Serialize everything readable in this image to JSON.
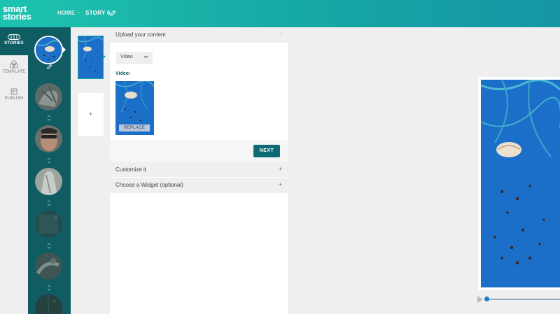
{
  "app": {
    "logo_line1": "smart",
    "logo_line2": "stories"
  },
  "breadcrumb": {
    "home": "HOME",
    "separator": "›",
    "current": "STORY 6"
  },
  "leftnav": {
    "stories": "STORIES",
    "template": "TEMPLATE",
    "publish": "PUBLISH"
  },
  "slides": {
    "add_label": "+"
  },
  "panel": {
    "upload_title": "Upload your content",
    "upload_sign": "-",
    "content_type": "Video",
    "video_label": "Video:",
    "replace_label": "REPLACE",
    "next_label": "NEXT",
    "customize_title": "Customize it",
    "customize_sign": "+",
    "widget_title": "Choose a Widget (optional)",
    "widget_sign": "+"
  },
  "colors": {
    "header_start": "#1ec3b0",
    "header_end": "#1596a7",
    "rail": "#0f5c62",
    "accent": "#0f6a76",
    "ocean_blue": "#1b6fc9"
  },
  "icons": [
    "edit-icon",
    "stories-icon",
    "template-icon",
    "publish-icon",
    "chevron-down-icon",
    "reorder-icon",
    "play-icon"
  ]
}
